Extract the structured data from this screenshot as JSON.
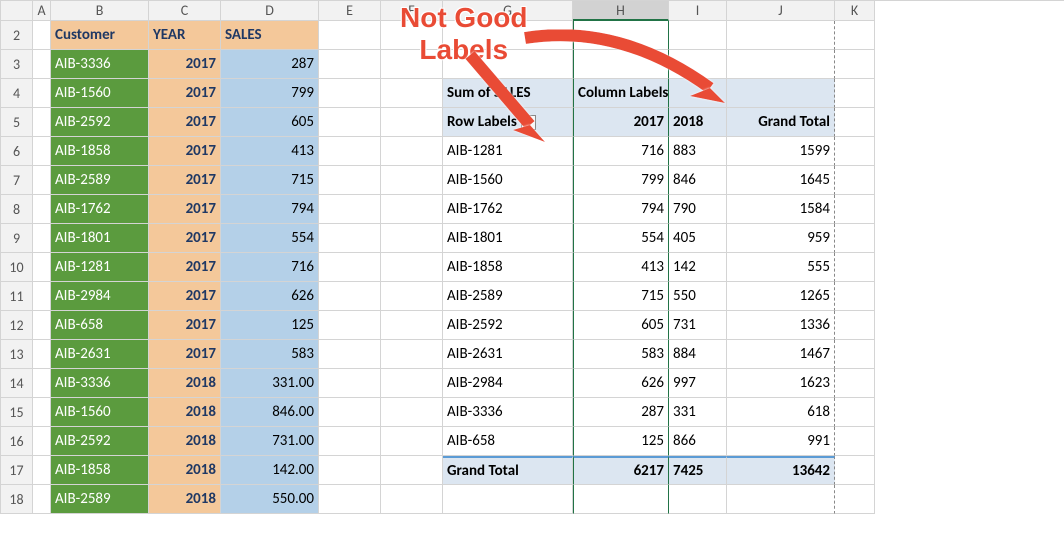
{
  "columns": {
    "A": "A",
    "B": "B",
    "C": "C",
    "D": "D",
    "E": "E",
    "F": "F",
    "G": "G",
    "H": "H",
    "I": "I",
    "J": "J",
    "K": "K"
  },
  "rows": [
    "2",
    "3",
    "4",
    "5",
    "6",
    "7",
    "8",
    "9",
    "10",
    "11",
    "12",
    "13",
    "14",
    "15",
    "16",
    "17",
    "18"
  ],
  "src": {
    "headers": {
      "customer": "Customer",
      "year": "YEAR",
      "sales": "SALES"
    },
    "data": [
      {
        "c": "AIB-3336",
        "y": "2017",
        "s": "287"
      },
      {
        "c": "AIB-1560",
        "y": "2017",
        "s": "799"
      },
      {
        "c": "AIB-2592",
        "y": "2017",
        "s": "605"
      },
      {
        "c": "AIB-1858",
        "y": "2017",
        "s": "413"
      },
      {
        "c": "AIB-2589",
        "y": "2017",
        "s": "715"
      },
      {
        "c": "AIB-1762",
        "y": "2017",
        "s": "794"
      },
      {
        "c": "AIB-1801",
        "y": "2017",
        "s": "554"
      },
      {
        "c": "AIB-1281",
        "y": "2017",
        "s": "716"
      },
      {
        "c": "AIB-2984",
        "y": "2017",
        "s": "626"
      },
      {
        "c": "AIB-658",
        "y": "2017",
        "s": "125"
      },
      {
        "c": "AIB-2631",
        "y": "2017",
        "s": "583"
      },
      {
        "c": "AIB-3336",
        "y": "2018",
        "s": "331.00"
      },
      {
        "c": "AIB-1560",
        "y": "2018",
        "s": "846.00"
      },
      {
        "c": "AIB-2592",
        "y": "2018",
        "s": "731.00"
      },
      {
        "c": "AIB-1858",
        "y": "2018",
        "s": "142.00"
      },
      {
        "c": "AIB-2589",
        "y": "2018",
        "s": "550.00"
      }
    ]
  },
  "pivot": {
    "sum_label": "Sum of SALES",
    "column_labels": "Column Labels",
    "row_labels": "Row Labels",
    "years": {
      "y1": "2017",
      "y2": "2018"
    },
    "grand_total_label": "Grand Total",
    "rows": [
      {
        "c": "AIB-1281",
        "v1": "716",
        "v2": "883",
        "t": "1599"
      },
      {
        "c": "AIB-1560",
        "v1": "799",
        "v2": "846",
        "t": "1645"
      },
      {
        "c": "AIB-1762",
        "v1": "794",
        "v2": "790",
        "t": "1584"
      },
      {
        "c": "AIB-1801",
        "v1": "554",
        "v2": "405",
        "t": "959"
      },
      {
        "c": "AIB-1858",
        "v1": "413",
        "v2": "142",
        "t": "555"
      },
      {
        "c": "AIB-2589",
        "v1": "715",
        "v2": "550",
        "t": "1265"
      },
      {
        "c": "AIB-2592",
        "v1": "605",
        "v2": "731",
        "t": "1336"
      },
      {
        "c": "AIB-2631",
        "v1": "583",
        "v2": "884",
        "t": "1467"
      },
      {
        "c": "AIB-2984",
        "v1": "626",
        "v2": "997",
        "t": "1623"
      },
      {
        "c": "AIB-3336",
        "v1": "287",
        "v2": "331",
        "t": "618"
      },
      {
        "c": "AIB-658",
        "v1": "125",
        "v2": "866",
        "t": "991"
      }
    ],
    "grand_total": {
      "v1": "6217",
      "v2": "7425",
      "t": "13642"
    }
  },
  "annotation": {
    "line1": "Not Good",
    "line2": "Labels"
  }
}
